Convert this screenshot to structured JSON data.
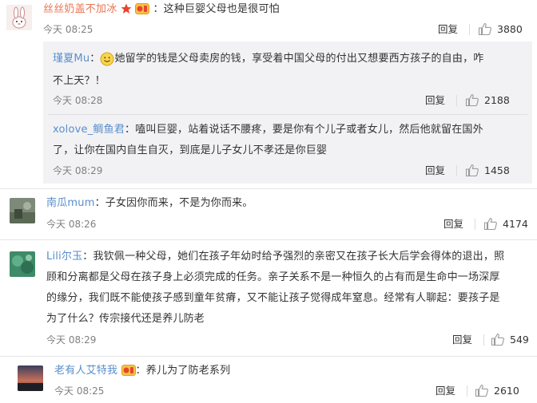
{
  "reply_label": "回复",
  "comments": [
    {
      "name": "丝丝奶盖不加冰",
      "text": "：这种巨婴父母也是很可怕",
      "time": "今天 08:25",
      "likes": "3880"
    },
    {
      "name": "瑾夏Mu",
      "colon": "：",
      "line1": "她留学的钱是父母卖房的钱，享受着中国父母的付出又想要西方孩子的自由，咋",
      "line2": "不上天？！",
      "time": "今天 08:28",
      "likes": "2188"
    },
    {
      "name": "xolove_鲷鱼君",
      "line1": "：嗑叫巨婴，站着说话不腰疼，要是你有个儿子或者女儿，然后他就留在国外",
      "line2": "了，让你在国内自生自灭，到底是儿子女儿不孝还是你巨婴",
      "time": "今天 08:29",
      "likes": "1458"
    },
    {
      "name": "南瓜mum",
      "text": "：子女因你而来，不是为你而来。",
      "time": "今天 08:26",
      "likes": "4174"
    },
    {
      "name": "Lili尔玉",
      "line1": "：我钦佩一种父母，她们在孩子年幼时给予强烈的亲密又在孩子长大后学会得体的退出，照",
      "line2": "顾和分离都是父母在孩子身上必须完成的任务。亲子关系不是一种恒久的占有而是生命中一场深厚",
      "line3": "的缘分，我们既不能使孩子感到童年贫瘠，又不能让孩子觉得成年窒息。经常有人聊起：要孩子是",
      "line4": "为了什么？传宗接代还是养儿防老",
      "time": "今天 08:29",
      "likes": "549"
    },
    {
      "name": "老有人艾特我",
      "text": "：养儿为了防老系列",
      "time": "今天 08:25",
      "likes": "2610"
    }
  ],
  "colors": {
    "name_orange": "#eb7350",
    "name_blue": "#5a8ec9",
    "sub_bg": "#f2f2f5",
    "time_gray": "#808080"
  }
}
